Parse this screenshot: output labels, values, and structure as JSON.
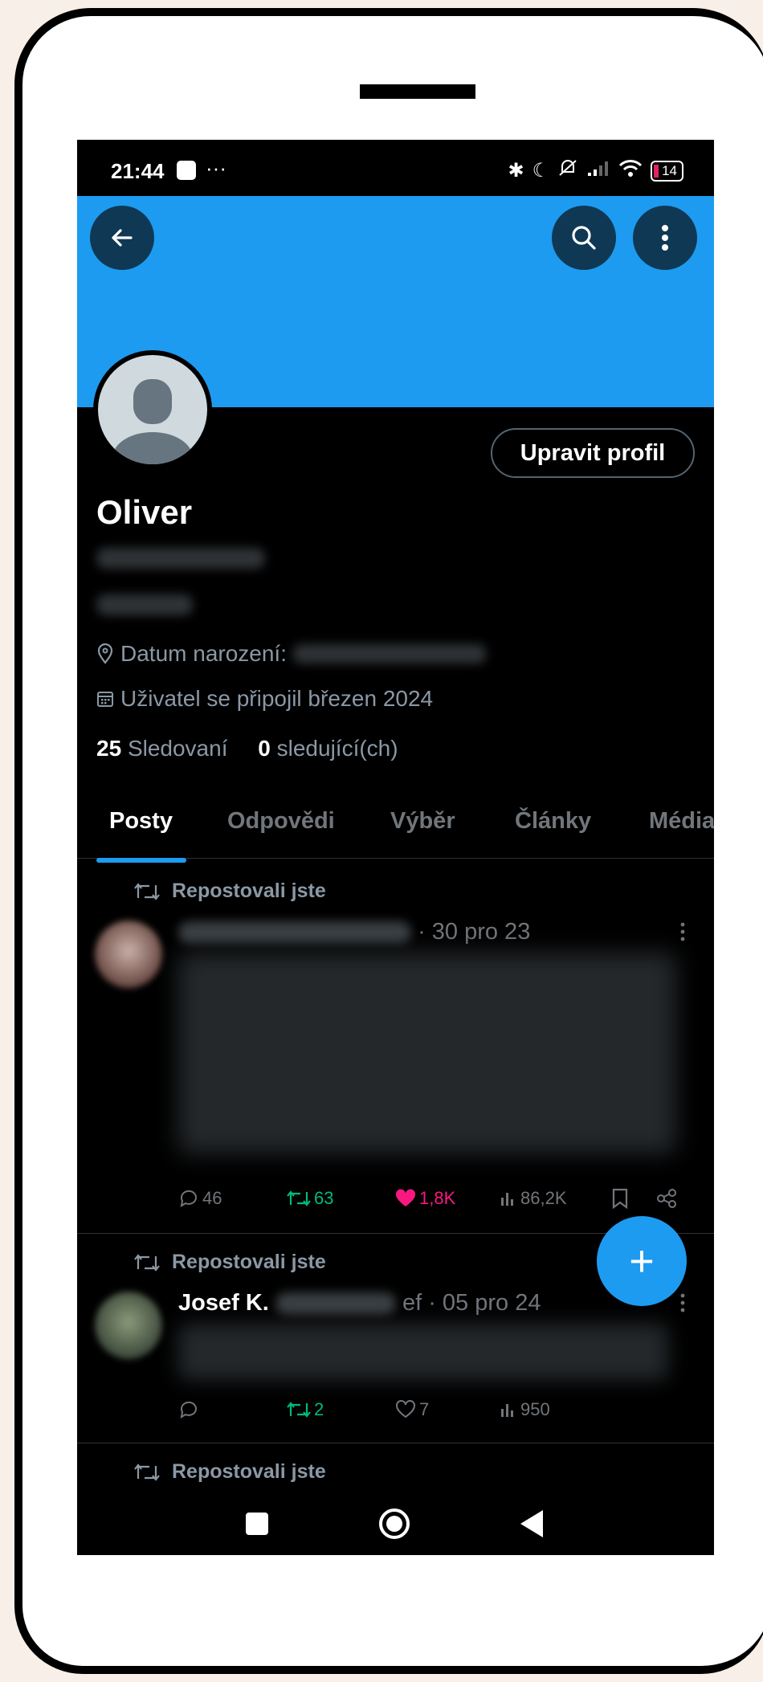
{
  "status_bar": {
    "time": "21:44",
    "dots": "···",
    "battery": "14"
  },
  "profile": {
    "name": "Oliver",
    "birthday_label": "Datum narození:",
    "joined": "Uživatel se připojil březen 2024",
    "following_count": "25",
    "following_label": "Sledovaní",
    "followers_count": "0",
    "followers_label": "sledující(ch)",
    "edit_button": "Upravit profil"
  },
  "tabs": [
    "Posty",
    "Odpovědi",
    "Výběr",
    "Články",
    "Média"
  ],
  "posts": [
    {
      "repost_label": "Repostovali jste",
      "name": "",
      "date": "· 30 pro 23",
      "replies": "46",
      "reposts": "63",
      "likes": "1,8K",
      "views": "86,2K",
      "liked": true
    },
    {
      "repost_label": "Repostovali jste",
      "name": "Josef K.",
      "date": "ef · 05 pro 24",
      "replies": "",
      "reposts": "2",
      "likes": "7",
      "views": "950",
      "liked": false
    },
    {
      "repost_label": "Repostovali jste"
    }
  ],
  "fab": "+",
  "colors": {
    "accent": "#1d9bf0",
    "banner": "#1d9bf0",
    "repost_green": "#00ba7c",
    "like_pink": "#f91880"
  }
}
